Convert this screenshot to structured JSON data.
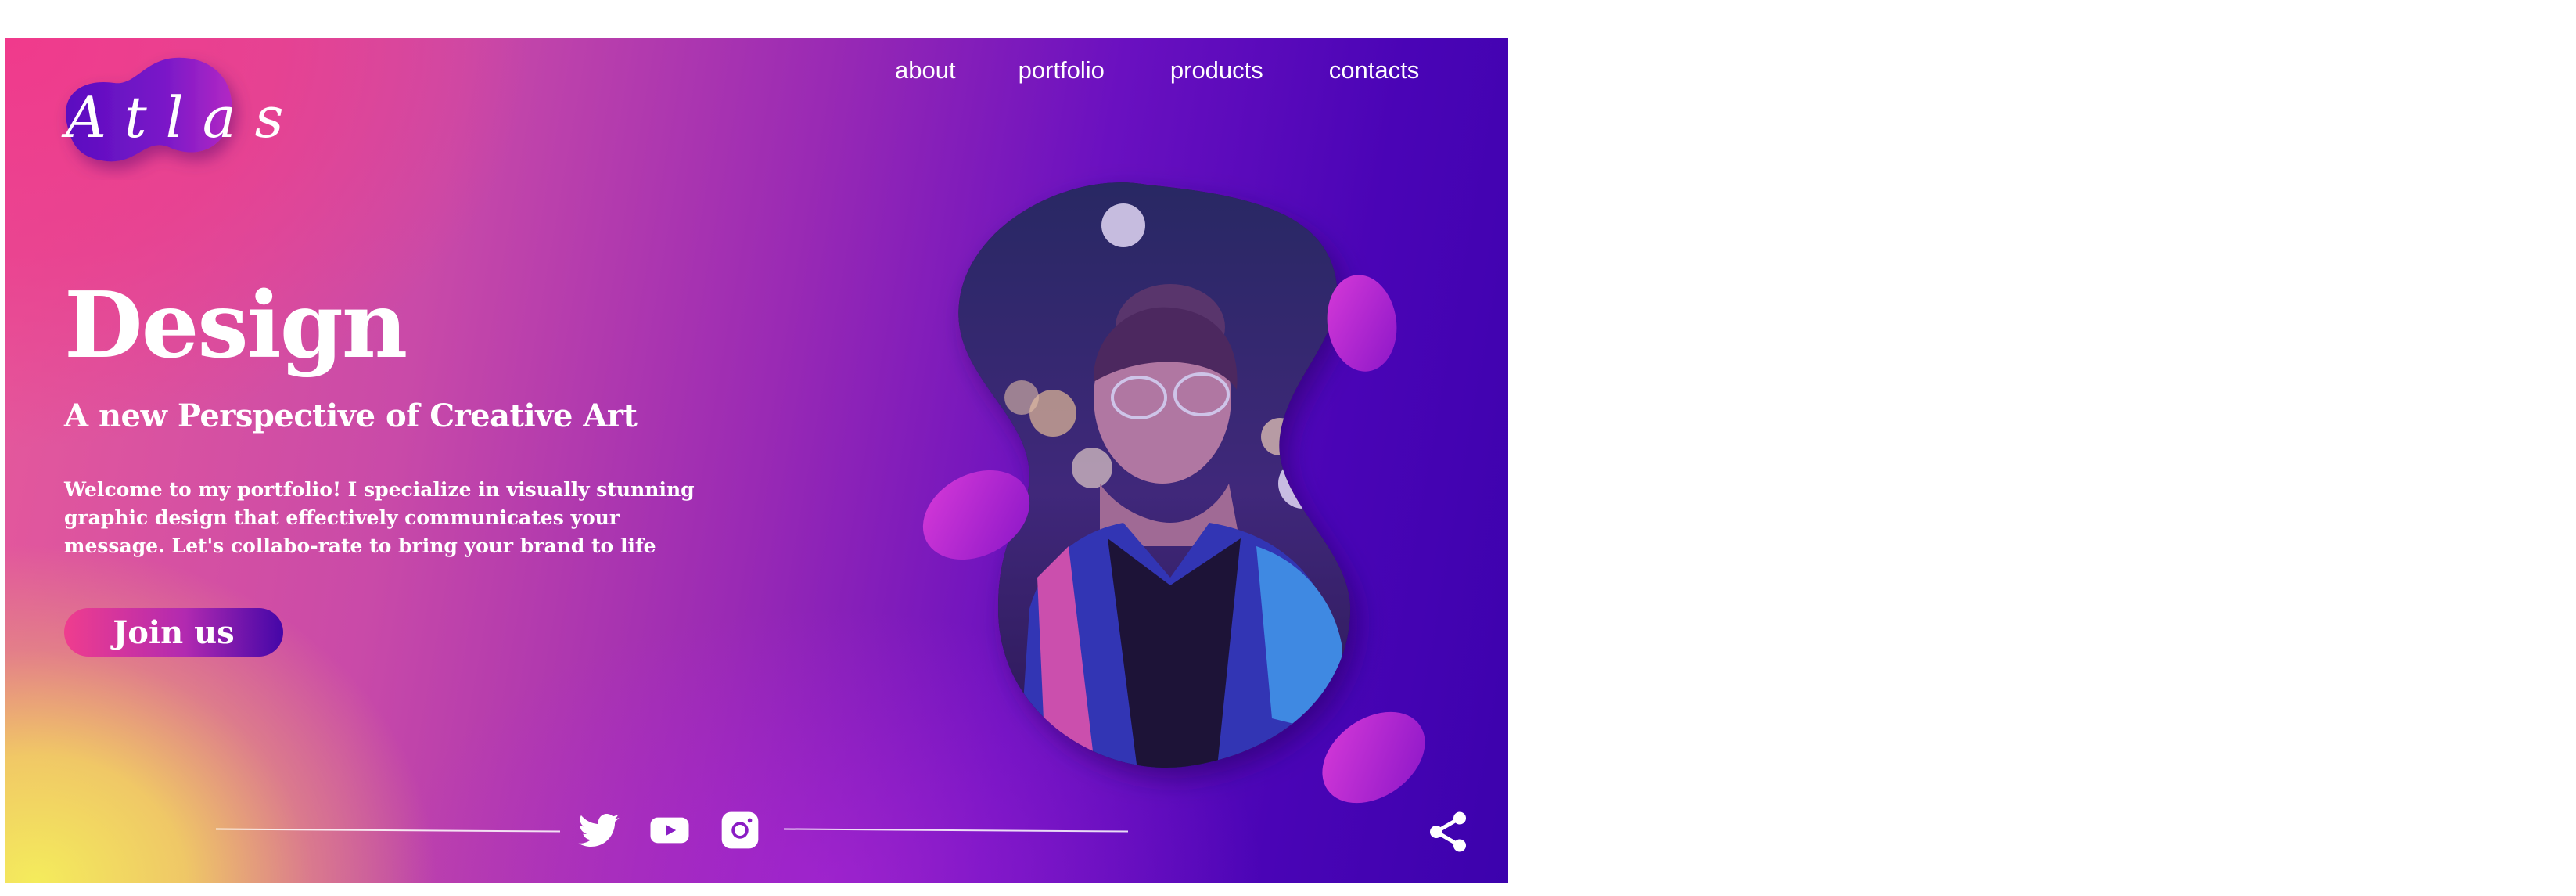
{
  "brand": {
    "logo_text": "Atlas"
  },
  "nav": {
    "items": [
      "about",
      "portfolio",
      "products",
      "contacts"
    ]
  },
  "hero": {
    "title": "Design",
    "subtitle": "A new Perspective of Creative Art",
    "description": "Welcome to my portfolio! I specialize in visually stunning graphic design that effectively communicates your message. Let's collabo-rate to bring your brand to life",
    "cta_label": "Join us"
  },
  "social": {
    "icons": [
      "twitter-icon",
      "youtube-icon",
      "instagram-icon"
    ],
    "share_icon": "share-icon"
  },
  "colors": {
    "pink": "#ef3d8e",
    "purple": "#9a2ab4",
    "deep_violet": "#3c02ad",
    "yellow": "#f4ec5c",
    "text": "#ffffff"
  }
}
